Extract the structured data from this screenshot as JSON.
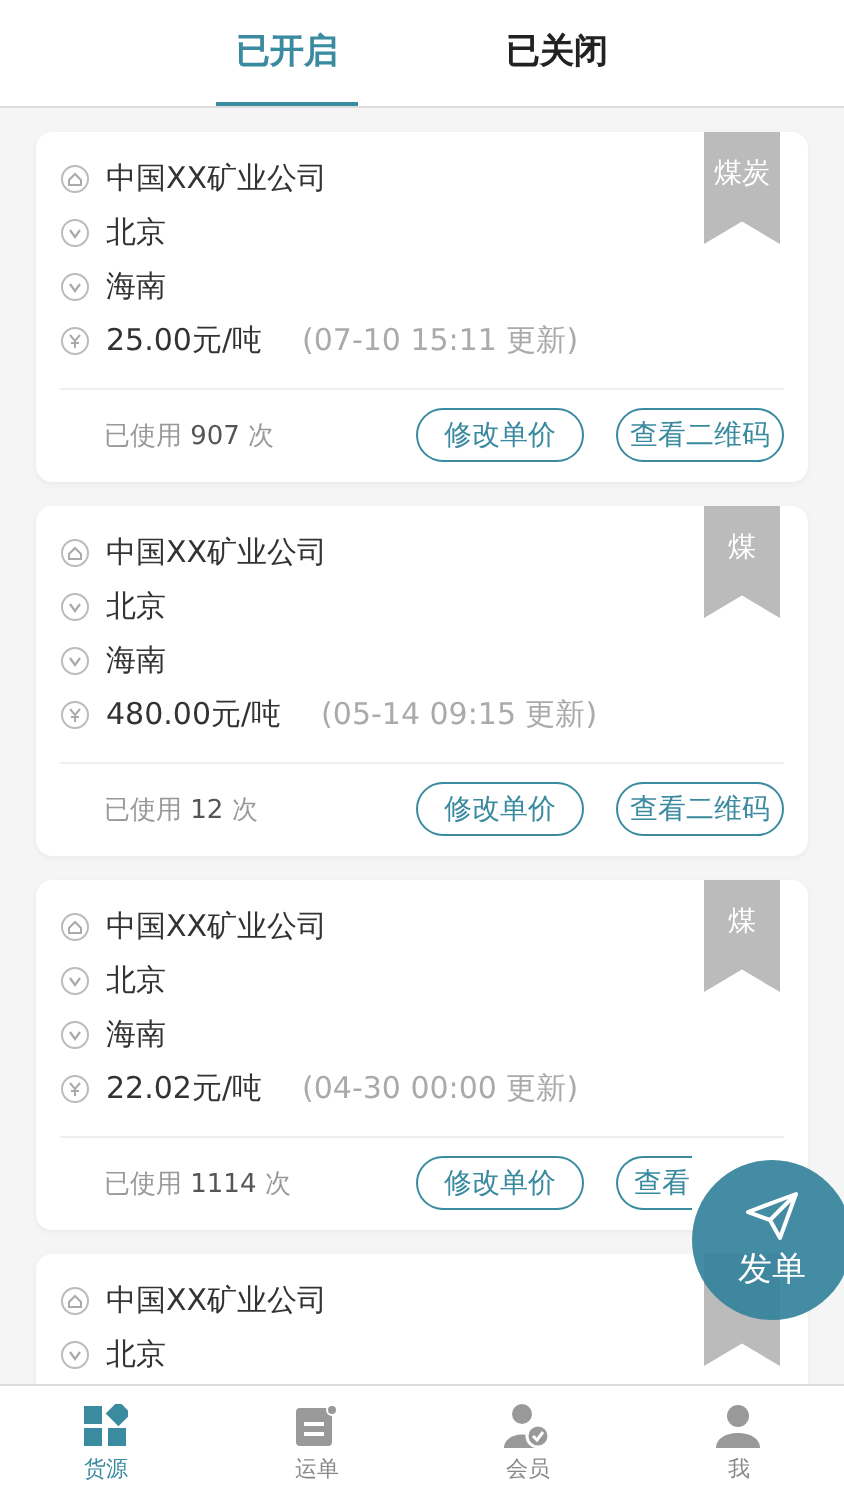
{
  "tabs": [
    {
      "label": "已开启",
      "selected": true
    },
    {
      "label": "已关闭",
      "selected": false
    }
  ],
  "cards": [
    {
      "company": "中国XX矿业公司",
      "origin": "北京",
      "destination": "海南",
      "price": "25.00元/吨",
      "updated": "(07-10 15:11 更新)",
      "tag": "煤炭",
      "used_prefix": "已使用",
      "used_count": "907",
      "used_suffix": "次",
      "buttons": [
        "修改单价",
        "查看二维码"
      ]
    },
    {
      "company": "中国XX矿业公司",
      "origin": "北京",
      "destination": "海南",
      "price": "480.00元/吨",
      "updated": "(05-14 09:15 更新)",
      "tag": "煤",
      "used_prefix": "已使用",
      "used_count": "12",
      "used_suffix": "次",
      "buttons": [
        "修改单价",
        "查看二维码"
      ]
    },
    {
      "company": "中国XX矿业公司",
      "origin": "北京",
      "destination": "海南",
      "price": "22.02元/吨",
      "updated": "(04-30 00:00 更新)",
      "tag": "煤",
      "used_prefix": "已使用",
      "used_count": "1114",
      "used_suffix": "次",
      "buttons": [
        "修改单价",
        "查看"
      ]
    },
    {
      "company": "中国XX矿业公司",
      "origin": "北京",
      "ribbon": true
    }
  ],
  "fab": {
    "label": "发单"
  },
  "nav": [
    {
      "label": "货源",
      "kind": "grid",
      "selected": true
    },
    {
      "label": "运单",
      "kind": "doc",
      "selected": false
    },
    {
      "label": "会员",
      "kind": "member",
      "selected": false
    },
    {
      "label": "我",
      "kind": "person",
      "selected": false
    }
  ]
}
